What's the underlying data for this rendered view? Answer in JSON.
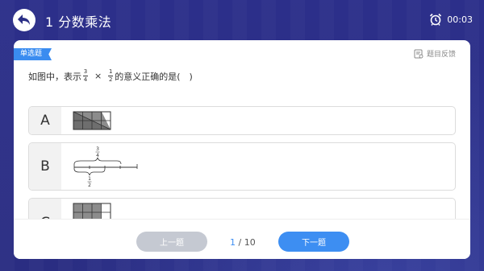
{
  "header": {
    "title": "1 分数乘法",
    "timer": "00:03"
  },
  "question": {
    "badge": "单选题",
    "feedback": "题目反馈",
    "prefix": "如图中，表示",
    "frac1_num": "3",
    "frac1_den": "4",
    "times": "×",
    "frac2_num": "1",
    "frac2_den": "2",
    "suffix": "的意义正确的是(　)"
  },
  "options": [
    {
      "letter": "A"
    },
    {
      "letter": "B",
      "upper_num": "3",
      "upper_den": "4",
      "lower_num": "1",
      "lower_den": "2"
    },
    {
      "letter": "C"
    }
  ],
  "pager": {
    "current": "1",
    "separator": " / ",
    "total": "10",
    "prev_label": "上一题",
    "next_label": "下一题"
  },
  "colors": {
    "background": "#2b2f86",
    "accent": "#3d8ef2",
    "badge": "#3a8cf0",
    "disabled": "#c5c9d2",
    "shaded": "#8c8c8c"
  }
}
